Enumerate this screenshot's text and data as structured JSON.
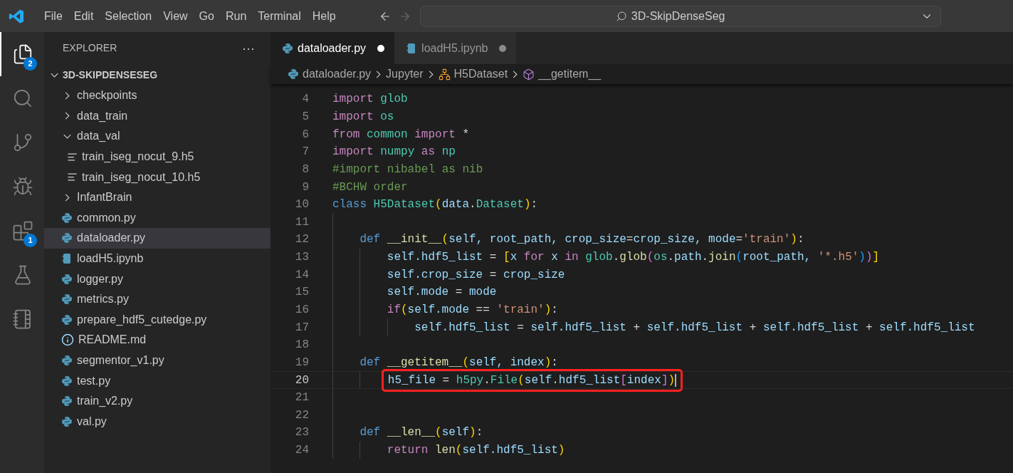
{
  "menu": [
    "File",
    "Edit",
    "Selection",
    "View",
    "Go",
    "Run",
    "Terminal",
    "Help"
  ],
  "nav": {
    "back_disabled": false,
    "forward_disabled": true
  },
  "command_center": {
    "text": "3D-SkipDenseSeg"
  },
  "activity_bar": [
    {
      "kind": "explorer",
      "selected": true,
      "badge": "2"
    },
    {
      "kind": "search",
      "selected": false
    },
    {
      "kind": "source-control",
      "selected": false
    },
    {
      "kind": "run-debug",
      "selected": false
    },
    {
      "kind": "extensions",
      "selected": false,
      "badge": "1"
    },
    {
      "kind": "testing",
      "selected": false
    },
    {
      "kind": "notebook",
      "selected": false
    }
  ],
  "sidebar": {
    "title": "EXPLORER",
    "more": "···",
    "root": {
      "label": "3D-SKIPDENSESEG",
      "expanded": true
    },
    "items": [
      {
        "kind": "folder",
        "label": "checkpoints",
        "expanded": false,
        "selected": false
      },
      {
        "kind": "folder",
        "label": "data_train",
        "expanded": false,
        "selected": false
      },
      {
        "kind": "folder",
        "label": "data_val",
        "expanded": true,
        "selected": false,
        "children": [
          {
            "kind": "data",
            "label": "train_iseg_nocut_9.h5",
            "selected": false
          },
          {
            "kind": "data",
            "label": "train_iseg_nocut_10.h5",
            "selected": false
          }
        ]
      },
      {
        "kind": "folder",
        "label": "InfantBrain",
        "expanded": false,
        "selected": false
      },
      {
        "kind": "python",
        "label": "common.py",
        "selected": false
      },
      {
        "kind": "python",
        "label": "dataloader.py",
        "selected": true
      },
      {
        "kind": "notebook",
        "label": "loadH5.ipynb",
        "selected": false
      },
      {
        "kind": "python",
        "label": "logger.py",
        "selected": false
      },
      {
        "kind": "python",
        "label": "metrics.py",
        "selected": false
      },
      {
        "kind": "python",
        "label": "prepare_hdf5_cutedge.py",
        "selected": false
      },
      {
        "kind": "info",
        "label": "README.md",
        "selected": false
      },
      {
        "kind": "python",
        "label": "segmentor_v1.py",
        "selected": false
      },
      {
        "kind": "python",
        "label": "test.py",
        "selected": false
      },
      {
        "kind": "python",
        "label": "train_v2.py",
        "selected": false
      },
      {
        "kind": "python",
        "label": "val.py",
        "selected": false
      }
    ]
  },
  "tabs": [
    {
      "kind": "python",
      "label": "dataloader.py",
      "selected": true,
      "modified": true
    },
    {
      "kind": "notebook",
      "label": "loadH5.ipynb",
      "selected": false,
      "modified": true
    }
  ],
  "breadcrumb": [
    {
      "kind": "python",
      "label": "dataloader.py"
    },
    {
      "kind": "text",
      "label": "Jupyter"
    },
    {
      "kind": "class",
      "label": "H5Dataset"
    },
    {
      "kind": "method",
      "label": "__getitem__"
    }
  ],
  "code": [
    {
      "n": "4",
      "tokens": [
        {
          "kind": "kw",
          "text": "import "
        },
        {
          "kind": "mod",
          "text": "glob"
        }
      ]
    },
    {
      "n": "5",
      "tokens": [
        {
          "kind": "kw",
          "text": "import "
        },
        {
          "kind": "mod",
          "text": "os"
        }
      ]
    },
    {
      "n": "6",
      "tokens": [
        {
          "kind": "kw",
          "text": "from "
        },
        {
          "kind": "mod",
          "text": "common "
        },
        {
          "kind": "kw",
          "text": "import "
        },
        {
          "kind": "plain",
          "text": "*"
        }
      ]
    },
    {
      "n": "7",
      "tokens": [
        {
          "kind": "kw",
          "text": "import "
        },
        {
          "kind": "mod",
          "text": "numpy "
        },
        {
          "kind": "kw",
          "text": "as "
        },
        {
          "kind": "mod",
          "text": "np"
        }
      ]
    },
    {
      "n": "8",
      "tokens": [
        {
          "kind": "cm",
          "text": "#import nibabel as nib"
        }
      ]
    },
    {
      "n": "9",
      "tokens": [
        {
          "kind": "cm",
          "text": "#BCHW order"
        }
      ]
    },
    {
      "n": "10",
      "tokens": [
        {
          "kind": "def",
          "text": "class "
        },
        {
          "kind": "mod",
          "text": "H5Dataset"
        },
        {
          "kind": "br1",
          "text": "("
        },
        {
          "kind": "var",
          "text": "data"
        },
        {
          "kind": "plain",
          "text": "."
        },
        {
          "kind": "mod",
          "text": "Dataset"
        },
        {
          "kind": "br1",
          "text": ")"
        },
        {
          "kind": "plain",
          "text": ":"
        }
      ],
      "children": [
        {
          "n": "11"
        },
        {
          "n": "12",
          "tokens": [
            {
              "kind": "def",
              "text": "def "
            },
            {
              "kind": "fn",
              "text": "__init__"
            },
            {
              "kind": "br1",
              "text": "("
            },
            {
              "kind": "var",
              "text": "self, root_path, crop_size"
            },
            {
              "kind": "plain",
              "text": "="
            },
            {
              "kind": "var",
              "text": "crop_size, mode"
            },
            {
              "kind": "plain",
              "text": "="
            },
            {
              "kind": "str",
              "text": "'train'"
            },
            {
              "kind": "br1",
              "text": ")"
            },
            {
              "kind": "plain",
              "text": ":"
            }
          ],
          "children": [
            {
              "n": "13",
              "tokens": [
                {
                  "kind": "var",
                  "text": "self.hdf5_list "
                },
                {
                  "kind": "plain",
                  "text": "= "
                },
                {
                  "kind": "br1",
                  "text": "["
                },
                {
                  "kind": "var",
                  "text": "x "
                },
                {
                  "kind": "kw",
                  "text": "for "
                },
                {
                  "kind": "var",
                  "text": "x "
                },
                {
                  "kind": "kw",
                  "text": "in "
                },
                {
                  "kind": "mod",
                  "text": "glob"
                },
                {
                  "kind": "plain",
                  "text": "."
                },
                {
                  "kind": "fn",
                  "text": "glob"
                },
                {
                  "kind": "br2",
                  "text": "("
                },
                {
                  "kind": "mod",
                  "text": "os"
                },
                {
                  "kind": "plain",
                  "text": "."
                },
                {
                  "kind": "var",
                  "text": "path"
                },
                {
                  "kind": "plain",
                  "text": "."
                },
                {
                  "kind": "fn",
                  "text": "join"
                },
                {
                  "kind": "br3",
                  "text": "("
                },
                {
                  "kind": "var",
                  "text": "root_path, "
                },
                {
                  "kind": "str",
                  "text": "'*.h5'"
                },
                {
                  "kind": "br3",
                  "text": ")"
                },
                {
                  "kind": "br2",
                  "text": ")"
                },
                {
                  "kind": "br1",
                  "text": "]"
                }
              ]
            },
            {
              "n": "14",
              "tokens": [
                {
                  "kind": "var",
                  "text": "self.crop_size "
                },
                {
                  "kind": "plain",
                  "text": "= "
                },
                {
                  "kind": "var",
                  "text": "crop_size"
                }
              ]
            },
            {
              "n": "15",
              "tokens": [
                {
                  "kind": "var",
                  "text": "self.mode "
                },
                {
                  "kind": "plain",
                  "text": "= "
                },
                {
                  "kind": "var",
                  "text": "mode"
                }
              ]
            },
            {
              "n": "16",
              "tokens": [
                {
                  "kind": "kw",
                  "text": "if"
                },
                {
                  "kind": "br1",
                  "text": "("
                },
                {
                  "kind": "var",
                  "text": "self.mode "
                },
                {
                  "kind": "plain",
                  "text": "== "
                },
                {
                  "kind": "str",
                  "text": "'train'"
                },
                {
                  "kind": "br1",
                  "text": ")"
                },
                {
                  "kind": "plain",
                  "text": ":"
                }
              ],
              "children": [
                {
                  "n": "17",
                  "tokens": [
                    {
                      "kind": "var",
                      "text": "self.hdf5_list "
                    },
                    {
                      "kind": "plain",
                      "text": "= "
                    },
                    {
                      "kind": "var",
                      "text": "self.hdf5_list "
                    },
                    {
                      "kind": "plain",
                      "text": "+ "
                    },
                    {
                      "kind": "var",
                      "text": "self.hdf5_list "
                    },
                    {
                      "kind": "plain",
                      "text": "+ "
                    },
                    {
                      "kind": "var",
                      "text": "self.hdf5_list "
                    },
                    {
                      "kind": "plain",
                      "text": "+ "
                    },
                    {
                      "kind": "var",
                      "text": "self.hdf5_list"
                    }
                  ]
                }
              ]
            }
          ]
        },
        {
          "n": "18"
        },
        {
          "n": "19",
          "tokens": [
            {
              "kind": "def",
              "text": "def "
            },
            {
              "kind": "fn",
              "text": "__getitem__"
            },
            {
              "kind": "br1",
              "text": "("
            },
            {
              "kind": "var",
              "text": "self, index"
            },
            {
              "kind": "br1",
              "text": ")"
            },
            {
              "kind": "plain",
              "text": ":"
            }
          ],
          "children": [
            {
              "n": "20",
              "active": true,
              "annotated": true,
              "tokens": [
                {
                  "kind": "var",
                  "text": "h5_file "
                },
                {
                  "kind": "plain",
                  "text": "= "
                },
                {
                  "kind": "mod",
                  "text": "h5py"
                },
                {
                  "kind": "plain",
                  "text": "."
                },
                {
                  "kind": "mod",
                  "text": "File"
                },
                {
                  "kind": "br1",
                  "text": "("
                },
                {
                  "kind": "var",
                  "text": "self.hdf5_list"
                },
                {
                  "kind": "br2",
                  "text": "["
                },
                {
                  "kind": "var",
                  "text": "index"
                },
                {
                  "kind": "br2",
                  "text": "]"
                },
                {
                  "kind": "br1",
                  "text": ")"
                }
              ]
            }
          ]
        },
        {
          "n": "21"
        },
        {
          "n": "22"
        },
        {
          "n": "23",
          "tokens": [
            {
              "kind": "def",
              "text": "def "
            },
            {
              "kind": "fn",
              "text": "__len__"
            },
            {
              "kind": "br1",
              "text": "("
            },
            {
              "kind": "var",
              "text": "self"
            },
            {
              "kind": "br1",
              "text": ")"
            },
            {
              "kind": "plain",
              "text": ":"
            }
          ],
          "children": [
            {
              "n": "24",
              "tokens": [
                {
                  "kind": "kw",
                  "text": "return "
                },
                {
                  "kind": "fn",
                  "text": "len"
                },
                {
                  "kind": "br1",
                  "text": "("
                },
                {
                  "kind": "var",
                  "text": "self.hdf5_list"
                },
                {
                  "kind": "br1",
                  "text": ")"
                }
              ]
            }
          ]
        }
      ]
    }
  ]
}
